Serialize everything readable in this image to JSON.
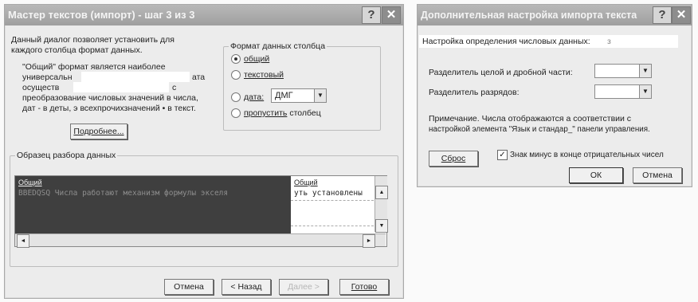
{
  "wizard": {
    "title": "Мастер текстов (импорт) - шаг 3 из 3",
    "help_glyph": "?",
    "close_glyph": "✕",
    "intro_line1": "Данный диалог позволяет установить для",
    "intro_line2": "каждого столбца формат данных.",
    "desc_line1": "\"Общий\" формат является наиболее",
    "desc_line2a": "универсальн",
    "desc_line2b": "ата",
    "desc_line3a": "осуществ",
    "desc_line3b": "с",
    "desc_line4": "преобразование числовых значений в числа,",
    "desc_line5": "дат - в деты, э всехпрочихзначений • в текст.",
    "more_button": "Подробнее...",
    "format_group_title": "Формат данных столбца",
    "radio_general": "общий",
    "radio_text": "текстовый",
    "radio_date": "дата:",
    "date_format": "ДМГ",
    "radio_skip": "пропустить",
    "radio_skip_tail": "столбец",
    "sample_group_title": "Образец разбора данных",
    "col1_header": "Общий",
    "col2_header": "Общий",
    "row1_col1": "BBEDQSQ  Числа работают механизм формулы экселя",
    "row1_col2": "уть установлены",
    "arrow_up": "▲",
    "arrow_down": "▼",
    "arrow_left": "◄",
    "arrow_right": "►",
    "cancel_button": "Отмена",
    "back_button": "< Назад",
    "next_button": "Далее >",
    "finish_button": "Готово"
  },
  "advanced": {
    "title": "Дополнительная настройка импорта текста",
    "help_glyph": "?",
    "close_glyph": "✕",
    "section_label": "Настройка определения числовых данных:",
    "section_tail": "з",
    "decimal_label": "Разделитель целой и дробной части:",
    "thousands_label": "Разделитель разрядов:",
    "combo_arrow": "▼",
    "note_line1": "Примечание. Числа отображаются а соответствии с",
    "note_line2": "настройкой элемента \"Язык и стандар_\" панели управления.",
    "reset_button": "Сброс",
    "minus_check": "✓",
    "minus_label": "Знак минус в конце отрицательных чисел",
    "ok_button": "ОК",
    "cancel_button": "Отмена"
  }
}
